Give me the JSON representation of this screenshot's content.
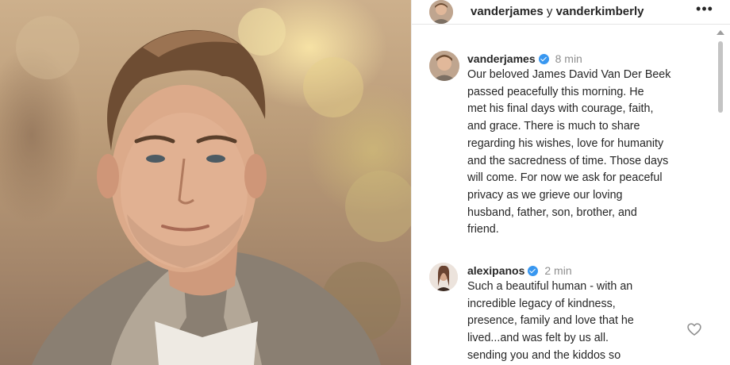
{
  "header": {
    "user1": "vanderjames",
    "joiner": " y ",
    "user2": "vanderkimberly",
    "more_label": "•••"
  },
  "caption": {
    "username": "vanderjames",
    "time": "8 min",
    "text": "Our beloved James David Van Der Beek\npassed peacefully this morning.  He\nmet his final days with courage, faith,\nand grace.  There is much to share\nregarding his wishes, love for humanity\nand the sacredness of time.  Those days\nwill come.  For now we ask for peaceful\nprivacy as we grieve our loving\nhusband, father, son, brother, and\nfriend."
  },
  "comment": {
    "username": "alexipanos",
    "time": "2 min",
    "text": "Such a beautiful human - with an\nincredible legacy of kindness,\npresence, family and love that he\nlived...and was felt by us all.\nsending you and the kiddos so"
  },
  "icons": {
    "verified": "verified-badge-icon",
    "like": "heart-icon",
    "more": "more-options-icon"
  },
  "colors": {
    "verified": "#3897f0",
    "text": "#262626",
    "secondary": "#8e8e8e"
  }
}
